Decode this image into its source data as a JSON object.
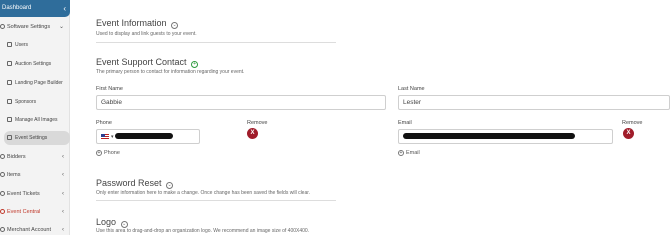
{
  "sidebar": {
    "dashboard": "Dashboard",
    "software_settings": "Software Settings",
    "sub_items": [
      "Users",
      "Auction Settings",
      "Landing Page Builder",
      "Sponsors",
      "Manage All Images",
      "Event Settings"
    ],
    "active_item": "Event Settings",
    "bidders": "Bidders",
    "items": "Items",
    "event_tickets": "Event Tickets",
    "event_central": "Event Central",
    "merchant_account": "Merchant Account"
  },
  "event_information": {
    "title": "Event Information",
    "subtitle": "Used to display and link guests to your event."
  },
  "support_contact": {
    "title": "Event Support Contact",
    "subtitle": "The primary person to contact for information regarding your event.",
    "first_name_label": "First Name",
    "first_name_value": "Gabbie",
    "last_name_label": "Last Name",
    "last_name_value": "Lester",
    "phone_label": "Phone",
    "remove_label": "Remove",
    "remove_icon": "X",
    "email_label": "Email",
    "add_phone": "Phone",
    "add_email": "Email",
    "add_icon": "+"
  },
  "password_reset": {
    "title": "Password Reset",
    "subtitle": "Only enter information here to make a change. Once change has been saved the fields will clear."
  },
  "logo": {
    "title": "Logo",
    "subtitle": "Use this area to drag-and-drop an organization logo. We recommend an image size of 400X400."
  },
  "colors": {
    "sidebar_active": "#2f6d9b",
    "remove_button": "#a01c2a",
    "add_icon_green": "#2e9b3e"
  }
}
